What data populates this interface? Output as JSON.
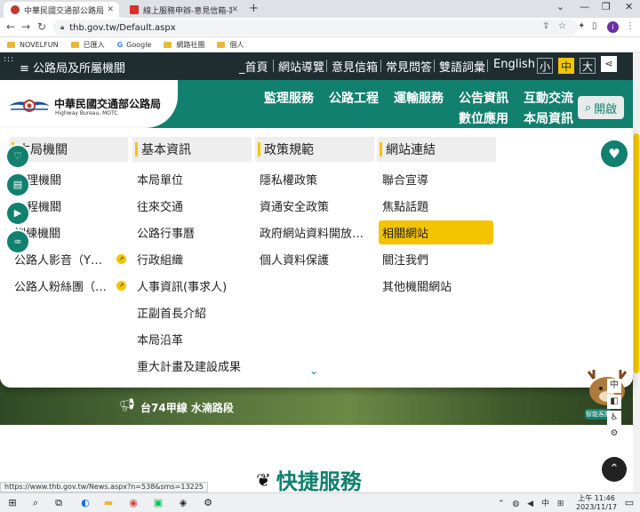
{
  "browser": {
    "tabs": [
      {
        "title": "中華民國交通部公路局",
        "active": true
      },
      {
        "title": "線上服務申辦-意見信箱-案件追蹤",
        "active": false
      }
    ],
    "new_tab": "+",
    "url": "thb.gov.tw/Default.aspx",
    "profile_initial": "i",
    "bookmarks": [
      "NOVELFUN",
      "已匯入",
      "Google",
      "網路社團",
      "個人"
    ],
    "status_url": "https://www.thb.gov.tw/News.aspx?n=538&sms=13225"
  },
  "site": {
    "top_bar": {
      "bureaus_label": "公路局及所屬機關",
      "links": [
        "_首頁",
        "網站導覽",
        "意見信箱",
        "常見問答",
        "雙語詞彙",
        "English"
      ],
      "font_sizes": [
        "小",
        "中",
        "大"
      ],
      "font_size_selected": "中"
    },
    "header": {
      "logo_zh": "中華民國交通部公路局",
      "logo_en": "Highway Bureau, MOTC",
      "nav_row1": [
        "監理服務",
        "公路工程",
        "運輸服務",
        "公告資訊",
        "互動交流"
      ],
      "nav_row2": [
        "數位應用",
        "本局資訊"
      ],
      "open_button": "開啟"
    },
    "menu": {
      "columns": [
        {
          "title": "本局機關",
          "items": [
            "理機關",
            "程機關",
            "訓練機關",
            "公路人影音（Y…",
            "公路人粉絲團（…"
          ]
        },
        {
          "title": "基本資訊",
          "items": [
            "本局單位",
            "往來交通",
            "公路行事曆",
            "行政組織",
            "人事資訊(事求人)",
            "正副首長介紹",
            "本局沿革",
            "重大計畫及建設成果"
          ]
        },
        {
          "title": "政策規範",
          "items": [
            "隱私權政策",
            "資通安全政策",
            "政府網站資料開放…",
            "個人資料保護"
          ]
        },
        {
          "title": "網站連結",
          "items": [
            "聯合宣導",
            "焦點話題",
            "相關網站",
            "關注我們",
            "其他機關網站"
          ]
        }
      ],
      "highlighted_item": "相關網站"
    },
    "right_tools": [
      "中",
      "◧"
    ],
    "assistant_label": "智能客服",
    "hero_news": "台74甲線 水湳路段",
    "quick_service_title": "快捷服務"
  },
  "taskbar": {
    "ime": "中",
    "time": "上午 11:46",
    "date": "2023/11/17"
  },
  "colors": {
    "brand_green": "#12806e",
    "accent_yellow": "#f5c400",
    "top_bar_dark": "#1f2d31"
  }
}
